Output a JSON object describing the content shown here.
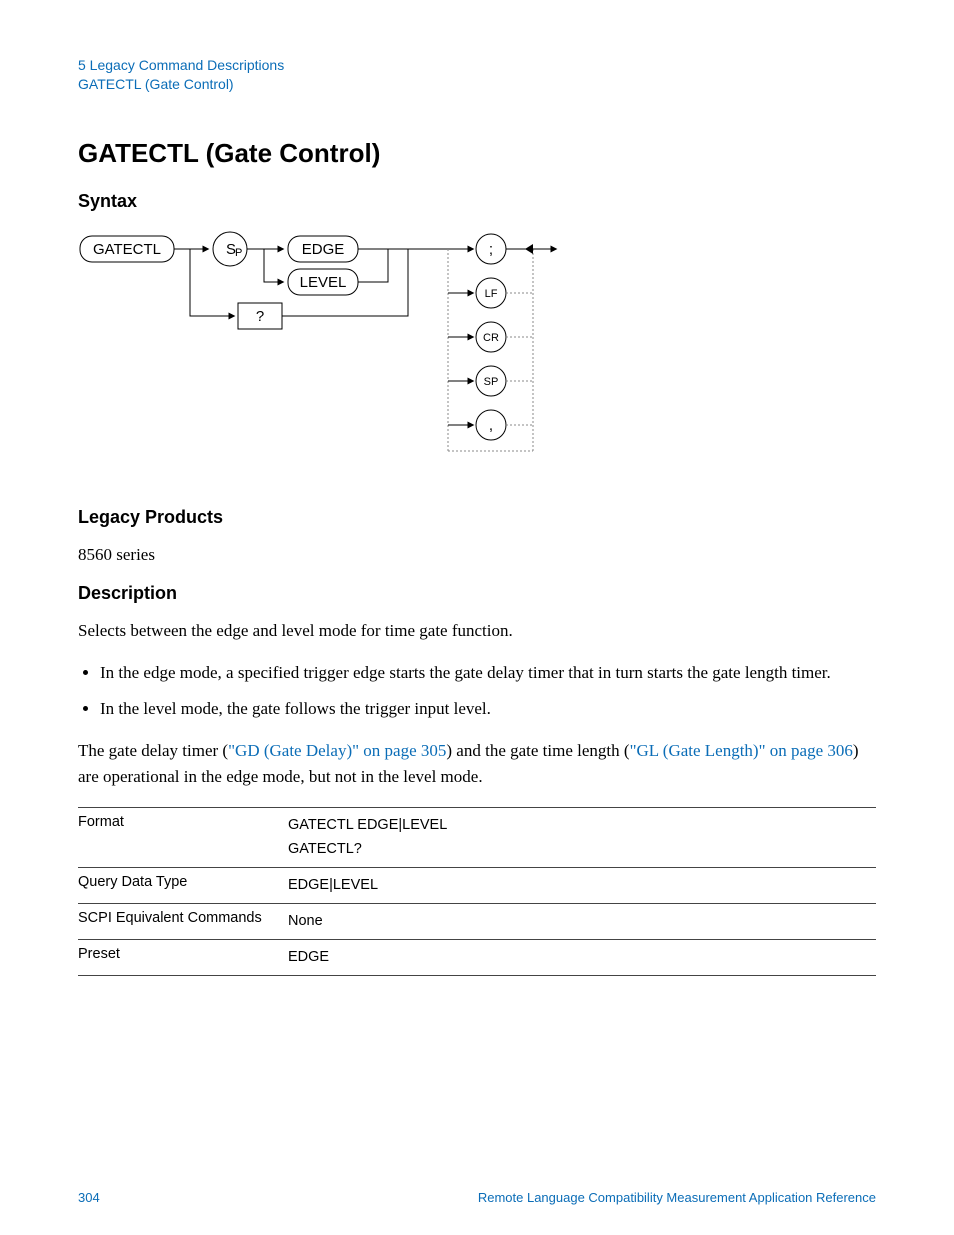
{
  "breadcrumb": {
    "chapter": "5  Legacy Command Descriptions",
    "topic": "GATECTL (Gate Control)"
  },
  "title": "GATECTL (Gate Control)",
  "sections": {
    "syntax": "Syntax",
    "legacy_products": "Legacy Products",
    "description": "Description"
  },
  "legacy_products_text": "8560 series",
  "description_intro": "Selects between the edge and level mode for time gate function.",
  "bullets": {
    "b1": "In the edge mode, a specified trigger edge starts the gate delay timer that in turn starts the gate length timer.",
    "b2": "In the level mode, the gate follows the trigger input level."
  },
  "para": {
    "p1": "The gate delay timer (",
    "link1": "\"GD (Gate Delay)\" on page 305",
    "p2": ") and the gate time length (",
    "link2": "\"GL (Gate Length)\" on page 306",
    "p3": ") are operational in the edge mode, but not in the level mode."
  },
  "table": {
    "rows": [
      {
        "label": "Format",
        "value": "GATECTL EDGE|LEVEL\nGATECTL?"
      },
      {
        "label": "Query Data Type",
        "value": "EDGE|LEVEL"
      },
      {
        "label": "SCPI Equivalent Commands",
        "value": "None"
      },
      {
        "label": "Preset",
        "value": "EDGE"
      }
    ]
  },
  "diagram": {
    "cmd": "GATECTL",
    "sp": "S",
    "sp_sub": "P",
    "edge": "EDGE",
    "level": "LEVEL",
    "q": "?",
    "term_semi": ";",
    "term_lf": "LF",
    "term_cr": "CR",
    "term_sp": "SP",
    "term_comma": ","
  },
  "footer": {
    "page": "304",
    "doc": "Remote Language Compatibility Measurement Application Reference"
  }
}
